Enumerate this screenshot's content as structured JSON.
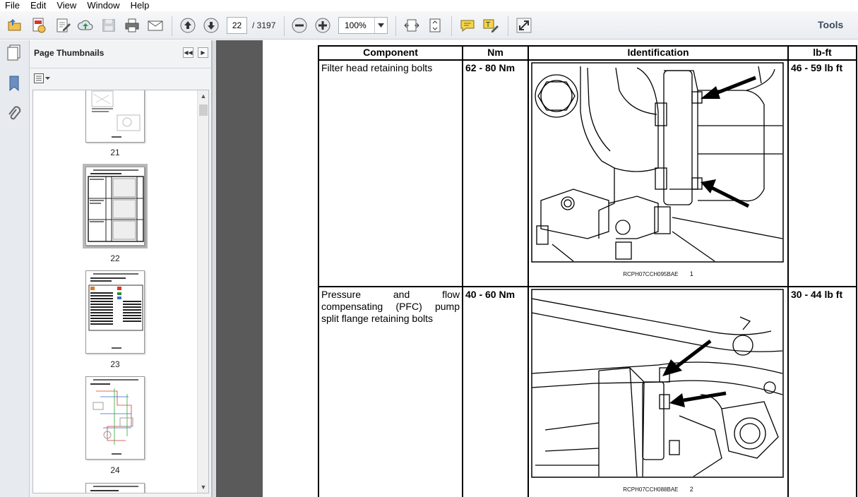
{
  "menu": [
    "File",
    "Edit",
    "View",
    "Window",
    "Help"
  ],
  "toolbar": {
    "current_page": "22",
    "page_total": "/ 3197",
    "zoom": "100%",
    "tools_label": "Tools"
  },
  "panel": {
    "title": "Page Thumbnails",
    "thumbnails": [
      {
        "label": "21"
      },
      {
        "label": "22",
        "selected": true
      },
      {
        "label": "23"
      },
      {
        "label": "24"
      }
    ]
  },
  "table": {
    "headers": [
      "Component",
      "Nm",
      "Identification",
      "lb-ft"
    ],
    "rows": [
      {
        "component": "Filter head retaining bolts",
        "nm": "62 - 80 Nm",
        "figure_code": "RCPH07CCH095BAE",
        "figure_num": "1",
        "lbft": "46 - 59 lb ft"
      },
      {
        "component": "Pressure and flow compensating (PFC) pump split flange retaining bolts",
        "nm": "40 - 60 Nm",
        "figure_code": "RCPH07CCH088BAE",
        "figure_num": "2",
        "lbft": "30 - 44 lb ft"
      }
    ]
  },
  "colors": {
    "toolbar_bg": "#eceff2",
    "doc_bg": "#5a5a5a",
    "tools_text": "#3b4a5e"
  }
}
